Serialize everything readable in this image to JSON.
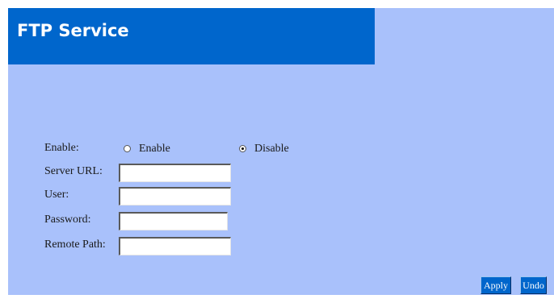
{
  "header": {
    "title": "FTP Service"
  },
  "form": {
    "enable": {
      "label": "Enable:",
      "options": [
        {
          "label": "Enable",
          "selected": false
        },
        {
          "label": "Disable",
          "selected": true
        }
      ]
    },
    "server_url": {
      "label": "Server URL:",
      "value": ""
    },
    "user": {
      "label": "User:",
      "value": ""
    },
    "password": {
      "label": "Password:",
      "value": ""
    },
    "remote_path": {
      "label": "Remote Path:",
      "value": ""
    }
  },
  "buttons": {
    "apply": "Apply",
    "undo": "Undo"
  },
  "colors": {
    "background": "#a9c1fb",
    "header": "#0066cc",
    "button": "#0066cc"
  }
}
